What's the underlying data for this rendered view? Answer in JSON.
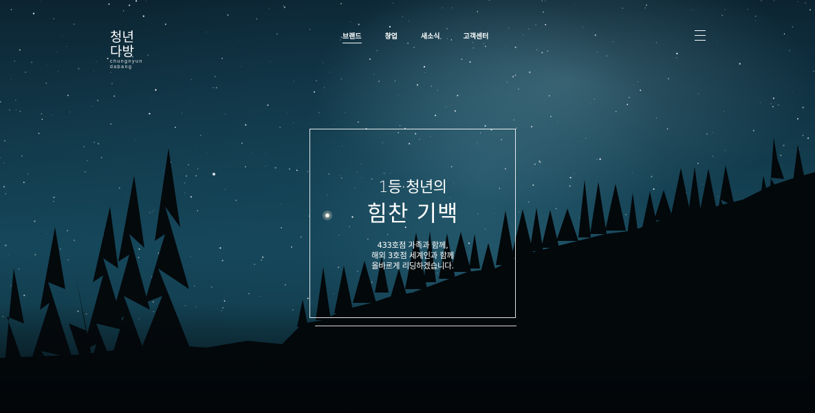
{
  "logo": {
    "line1": "청년",
    "line2": "다방",
    "sub1": "chungnyun",
    "sub2": "dabang"
  },
  "nav": {
    "items": [
      {
        "label": "브랜드",
        "active": true
      },
      {
        "label": "창업",
        "active": false
      },
      {
        "label": "새소식",
        "active": false
      },
      {
        "label": "고객센터",
        "active": false
      }
    ]
  },
  "menu": {
    "icon": "hamburger-menu-icon"
  },
  "hero": {
    "title_line1": "1등 청년의",
    "title_line2": "힘찬 기백",
    "desc_line1": "433호점 가족과 함께,",
    "desc_line2": "해외 3호점 세계인과 함께",
    "desc_line3": "올바르게 리딩하겠습니다."
  },
  "colors": {
    "sky_top": "#0c2432",
    "sky_mid": "#15475a",
    "text": "#ffffff",
    "silhouette": "#03080b"
  }
}
